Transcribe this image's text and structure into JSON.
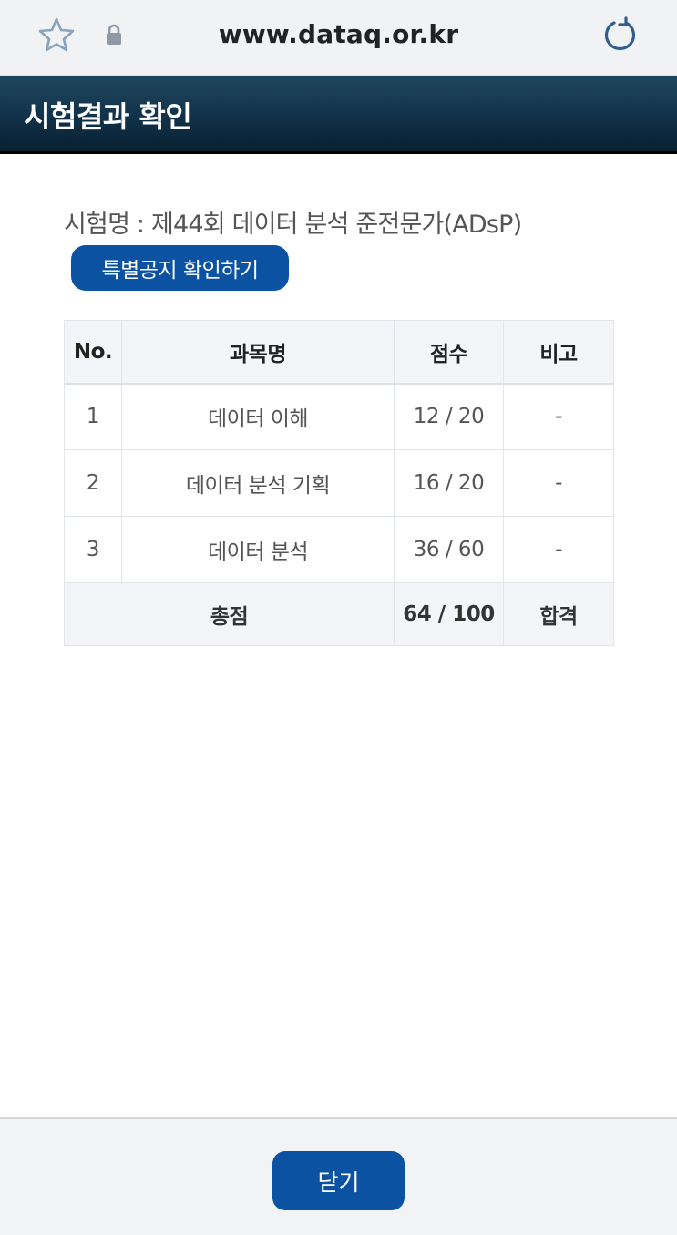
{
  "browser": {
    "url": "www.dataq.or.kr",
    "icons": [
      "star-icon",
      "lock-icon",
      "reload-icon"
    ]
  },
  "header": {
    "title": "시험결과 확인"
  },
  "exam": {
    "name": "시험명 : 제44회 데이터 분석 준전문가(ADsP)",
    "notice_button": "특별공지 확인하기"
  },
  "table": {
    "headers": [
      "No.",
      "과목명",
      "점수",
      "비고"
    ],
    "rows": [
      {
        "no": "1",
        "subject": "데이터 이해",
        "score": "12 / 20",
        "note": "-"
      },
      {
        "no": "2",
        "subject": "데이터 분석 기획",
        "score": "16 / 20",
        "note": "-"
      },
      {
        "no": "3",
        "subject": "데이터 분석",
        "score": "36 / 60",
        "note": "-"
      }
    ],
    "total": {
      "label": "총점",
      "score": "64 / 100",
      "result": "합격"
    }
  },
  "footer": {
    "close_button": "닫기"
  },
  "colors": {
    "accent": "#0b52a3",
    "header_bg": "#113249"
  }
}
